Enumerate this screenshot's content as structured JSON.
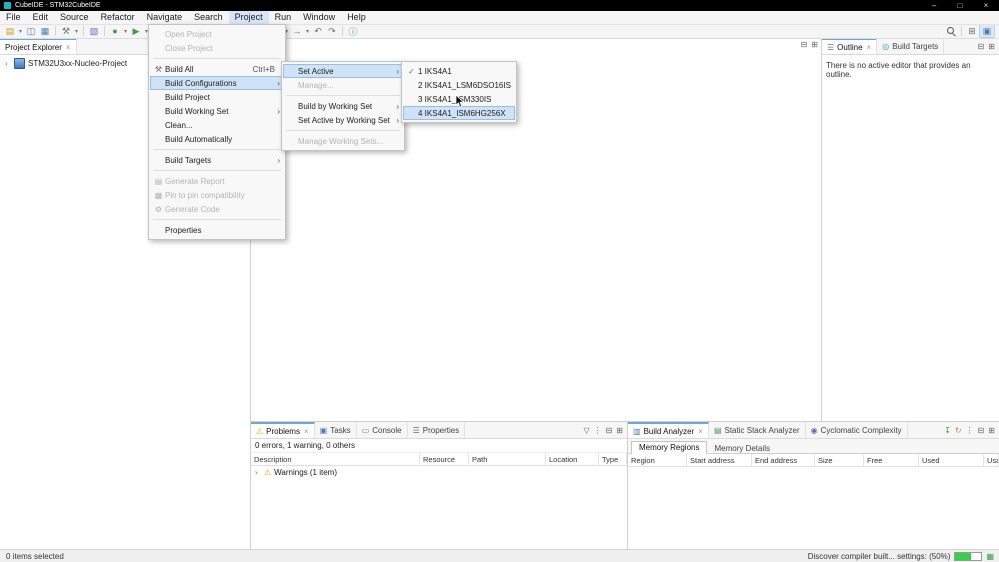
{
  "window": {
    "title": "CubeIDE - STM32CubeIDE",
    "controls": {
      "minimize": "–",
      "maximize": "□",
      "close": "×"
    }
  },
  "menubar": {
    "items": [
      "File",
      "Edit",
      "Source",
      "Refactor",
      "Navigate",
      "Search",
      "Project",
      "Run",
      "Window",
      "Help"
    ]
  },
  "icons": {
    "app-icon": "css-teal-square",
    "new-icon": "▤",
    "dropdown-icon": "▾",
    "save-icon": "◫",
    "save-all-icon": "▦",
    "build-all-icon": "⚒",
    "new-project-icon": "▧",
    "debug-icon": "●",
    "run-icon": "▶",
    "device-config-icon": "⚙",
    "code-gen-icon": "▨",
    "fill-icon": "◧",
    "highlight-icon": "▥",
    "wand-icon": "✦",
    "outline-toggle-icon": "≡",
    "back-icon": "←",
    "forward-icon": "→",
    "undo-icon": "↶",
    "redo-icon": "↷",
    "info-icon": "ⓘ",
    "search-icon": "css-magnifier",
    "open-perspective-icon": "⊞",
    "active-perspective-icon": "▣",
    "minimize-icon": "⊟",
    "maximize-icon": "⊞",
    "close-icon": "×",
    "collapse-all-icon": "⊟",
    "link-editor-icon": "⇄",
    "view-menu-icon": "⋮",
    "chevron-icon": "›",
    "submenu-arrow-icon": "›",
    "check-icon": "✓",
    "warning-icon": "⚠",
    "problems-icon": "⚠",
    "tasks-icon": "▣",
    "console-icon": "▭",
    "properties-icon": "☰",
    "outline-icon": "☰",
    "build-targets-icon": "◎",
    "build-analyzer-icon": "▥",
    "static-stack-icon": "▤",
    "cyclomatic-icon": "◉",
    "filter-icon": "▽",
    "export-icon": "↧",
    "refresh-icon": "↻",
    "jobs-icon": "▦"
  },
  "menus": {
    "project": {
      "open_project": "Open Project",
      "close_project": "Close Project",
      "build_all": "Build All",
      "build_all_shortcut": "Ctrl+B",
      "build_configurations": "Build Configurations",
      "build_project": "Build Project",
      "build_working_set": "Build Working Set",
      "clean": "Clean...",
      "build_automatically": "Build Automatically",
      "build_targets": "Build Targets",
      "generate_report": "Generate Report",
      "pin_compatibility": "Pin to pin compatibility",
      "generate_code": "Generate Code",
      "properties": "Properties"
    },
    "build_configurations": {
      "set_active": "Set Active",
      "manage": "Manage...",
      "build_by_working_set": "Build by Working Set",
      "set_active_by_working_set": "Set Active by Working Set",
      "manage_working_sets": "Manage Working Sets..."
    },
    "set_active": {
      "option1": "1 IKS4A1",
      "option2": "2 IKS4A1_LSM6DSO16IS",
      "option3": "3 IKS4A1_ISM330IS",
      "option4": "4 IKS4A1_ISM6HG256X",
      "checked": "1 IKS4A1",
      "hovered": "4 IKS4A1_ISM6HG256X"
    }
  },
  "project_explorer": {
    "tab": "Project Explorer",
    "project": "STM32U3xx-Nucleo-Project"
  },
  "outline_view": {
    "tab_outline": "Outline",
    "tab_build_targets": "Build Targets",
    "empty_message": "There is no active editor that provides an outline."
  },
  "problems_view": {
    "tab_problems": "Problems",
    "tab_tasks": "Tasks",
    "tab_console": "Console",
    "tab_properties": "Properties",
    "summary": "0 errors, 1 warning, 0 others",
    "columns": [
      "Description",
      "Resource",
      "Path",
      "Location",
      "Type"
    ],
    "rows": [
      {
        "description": "Warnings (1 item)"
      }
    ]
  },
  "build_analyzer": {
    "tab_build_analyzer": "Build Analyzer",
    "tab_static_stack": "Static Stack Analyzer",
    "tab_cyclomatic": "Cyclomatic Complexity",
    "subtab_regions": "Memory Regions",
    "subtab_details": "Memory Details",
    "columns": [
      "Region",
      "Start address",
      "End address",
      "Size",
      "Free",
      "Used",
      "Usage (%)"
    ]
  },
  "statusbar": {
    "selection": "0 items selected",
    "job_text": "Discover compiler built... settings: (50%)",
    "job_progress_percent": 50
  }
}
